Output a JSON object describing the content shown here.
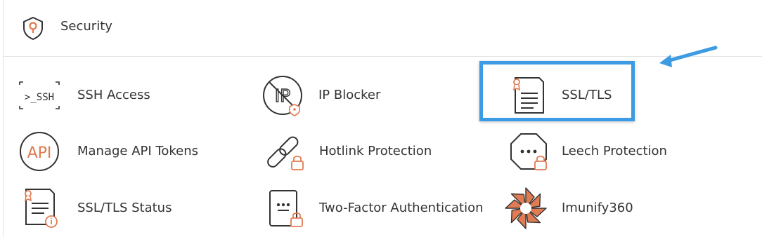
{
  "section": {
    "title": "Security",
    "icon": "shield-icon"
  },
  "ssh_glyph": ">_SSH",
  "api_glyph": "API",
  "ip_glyph": "IP",
  "items": [
    {
      "label": "SSH Access",
      "icon": "ssh-terminal-icon"
    },
    {
      "label": "IP Blocker",
      "icon": "ip-blocker-icon"
    },
    {
      "label": "SSL/TLS",
      "icon": "certificate-icon"
    },
    {
      "label": "Manage API Tokens",
      "icon": "api-icon"
    },
    {
      "label": "Hotlink Protection",
      "icon": "chain-link-lock-icon"
    },
    {
      "label": "Leech Protection",
      "icon": "octagon-lock-icon"
    },
    {
      "label": "SSL/TLS Status",
      "icon": "certificate-status-icon"
    },
    {
      "label": "Two-Factor Authentication",
      "icon": "two-factor-lock-icon"
    },
    {
      "label": "Imunify360",
      "icon": "imunify360-logo-icon"
    }
  ],
  "colors": {
    "accent": "#e07b53",
    "icon_stroke": "#333333",
    "highlight": "#3d9be3"
  }
}
